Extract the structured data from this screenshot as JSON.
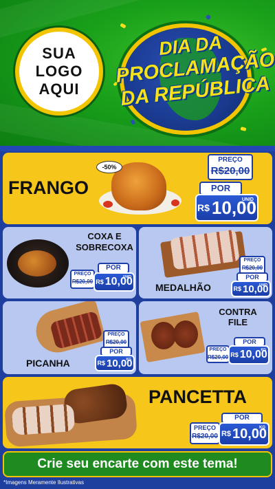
{
  "header": {
    "logo_lines": [
      "SUA",
      "LOGO",
      "AQUI"
    ],
    "title_line1": "DIA DA",
    "title_line2": "PROCLAMAÇÃO",
    "title_line3": "DA REPÚBLICA"
  },
  "products": {
    "frango": {
      "name": "FRANGO",
      "discount": "-50%",
      "preco_label": "PREÇO",
      "old_price": "R$20,00",
      "por_label": "POR",
      "currency": "R$",
      "price": "10,00",
      "unit": "UNID"
    },
    "coxa": {
      "name_line1": "COXA E",
      "name_line2": "SOBRECOXA",
      "preco_label": "PREÇO",
      "old_price": "R$20,00",
      "por_label": "POR",
      "currency": "R$",
      "price": "10,00",
      "unit": "UNID"
    },
    "medalhao": {
      "name": "MEDALHÃO",
      "preco_label": "PREÇO",
      "old_price": "R$20,00",
      "por_label": "POR",
      "currency": "R$",
      "price": "10,00",
      "unit": "UNID"
    },
    "picanha": {
      "name": "PICANHA",
      "preco_label": "PREÇO",
      "old_price": "R$20,00",
      "por_label": "POR",
      "currency": "R$",
      "price": "10,00",
      "unit": "KG"
    },
    "contrafile": {
      "name_line1": "CONTRA",
      "name_line2": "FILE",
      "preco_label": "PREÇO",
      "old_price": "R$20,00",
      "por_label": "POR",
      "currency": "R$",
      "price": "10,00",
      "unit": "KG"
    },
    "pancetta": {
      "name": "PANCETTA",
      "preco_label": "PREÇO",
      "old_price": "R$20,00",
      "por_label": "POR",
      "currency": "R$",
      "price": "10,00",
      "unit": "KG"
    }
  },
  "footer": {
    "cta": "Crie seu encarte com este tema!",
    "disclaimer": "*Imagens Meramente Ilustrativas"
  },
  "colors": {
    "green": "#19a01a",
    "yellow": "#f6c61a",
    "blue": "#1d3ea8",
    "lavender": "#b9c8f0"
  }
}
